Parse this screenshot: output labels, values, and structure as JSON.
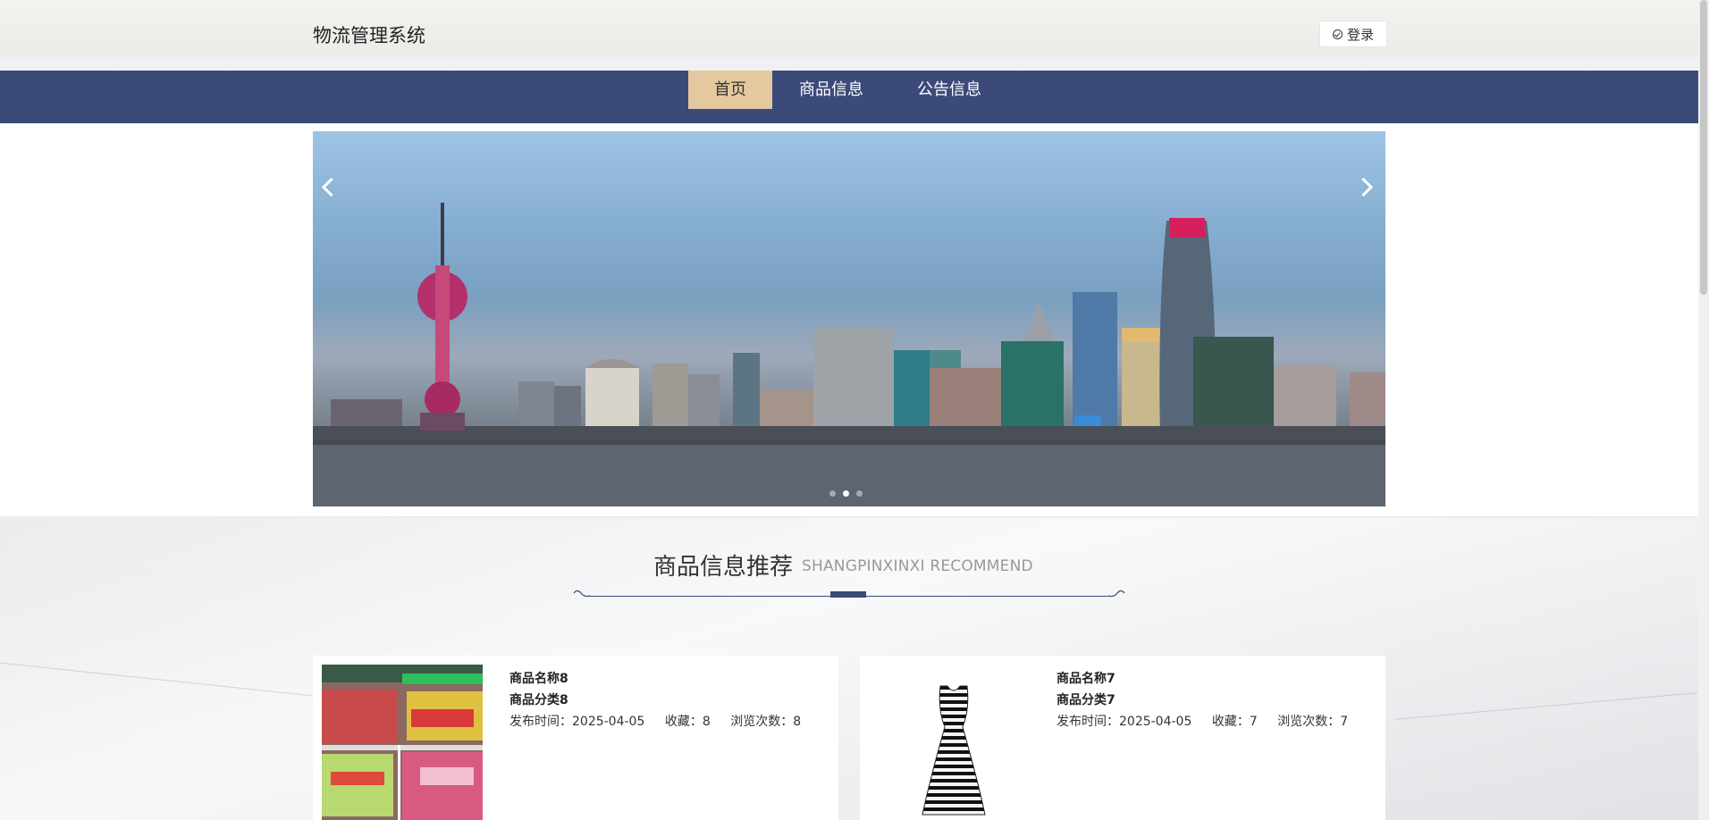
{
  "header": {
    "site_title": "物流管理系统",
    "login_label": "登录"
  },
  "nav": {
    "items": [
      {
        "label": "首页",
        "active": true
      },
      {
        "label": "商品信息",
        "active": false
      },
      {
        "label": "公告信息",
        "active": false
      }
    ]
  },
  "banner": {
    "slide_count": 3,
    "active_slide": 2
  },
  "section": {
    "title": "商品信息推荐",
    "subtitle": "SHANGPINXINXI RECOMMEND"
  },
  "products": [
    {
      "name": "商品名称8",
      "category": "商品分类8",
      "publish_label": "发布时间：2025-04-05",
      "favorites_label": "收藏：8",
      "views_label": "浏览次数：8"
    },
    {
      "name": "商品名称7",
      "category": "商品分类7",
      "publish_label": "发布时间：2025-04-05",
      "favorites_label": "收藏：7",
      "views_label": "浏览次数：7"
    }
  ],
  "colors": {
    "nav_bg": "#3b4a78",
    "nav_active": "#e3c8a0"
  }
}
